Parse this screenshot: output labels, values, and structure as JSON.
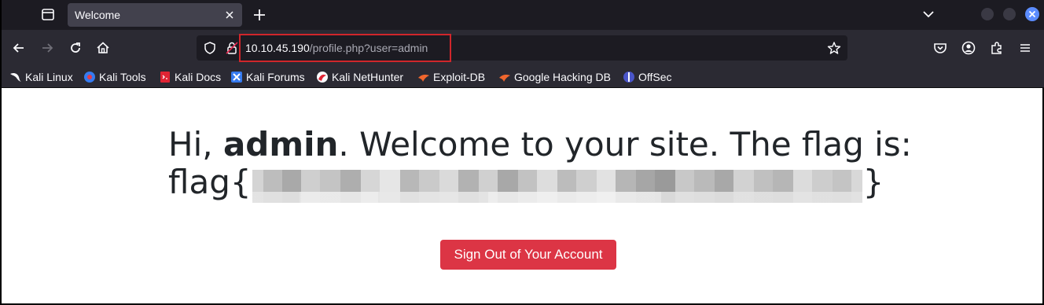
{
  "browser": {
    "tab": {
      "title": "Welcome"
    },
    "url": {
      "host": "10.10.45.190",
      "path": "/profile.php?user=admin"
    },
    "bookmarks": [
      {
        "label": "Kali Linux",
        "icon": "kali-dragon-icon"
      },
      {
        "label": "Kali Tools",
        "icon": "kali-tools-icon"
      },
      {
        "label": "Kali Docs",
        "icon": "kali-docs-icon"
      },
      {
        "label": "Kali Forums",
        "icon": "kali-forums-icon"
      },
      {
        "label": "Kali NetHunter",
        "icon": "kali-nethunter-icon"
      },
      {
        "label": "Exploit-DB",
        "icon": "exploit-db-icon"
      },
      {
        "label": "Google Hacking DB",
        "icon": "ghdb-icon"
      },
      {
        "label": "OffSec",
        "icon": "offsec-icon"
      }
    ]
  },
  "page": {
    "greeting_prefix": "Hi, ",
    "username": "admin",
    "greeting_suffix": ". Welcome to your site. The flag is:",
    "flag_prefix": "flag{",
    "flag_suffix": "}",
    "signout_label": "Sign Out of Your Account"
  },
  "colors": {
    "signout_button": "#dc3545",
    "url_highlight_border": "#d0262b"
  }
}
